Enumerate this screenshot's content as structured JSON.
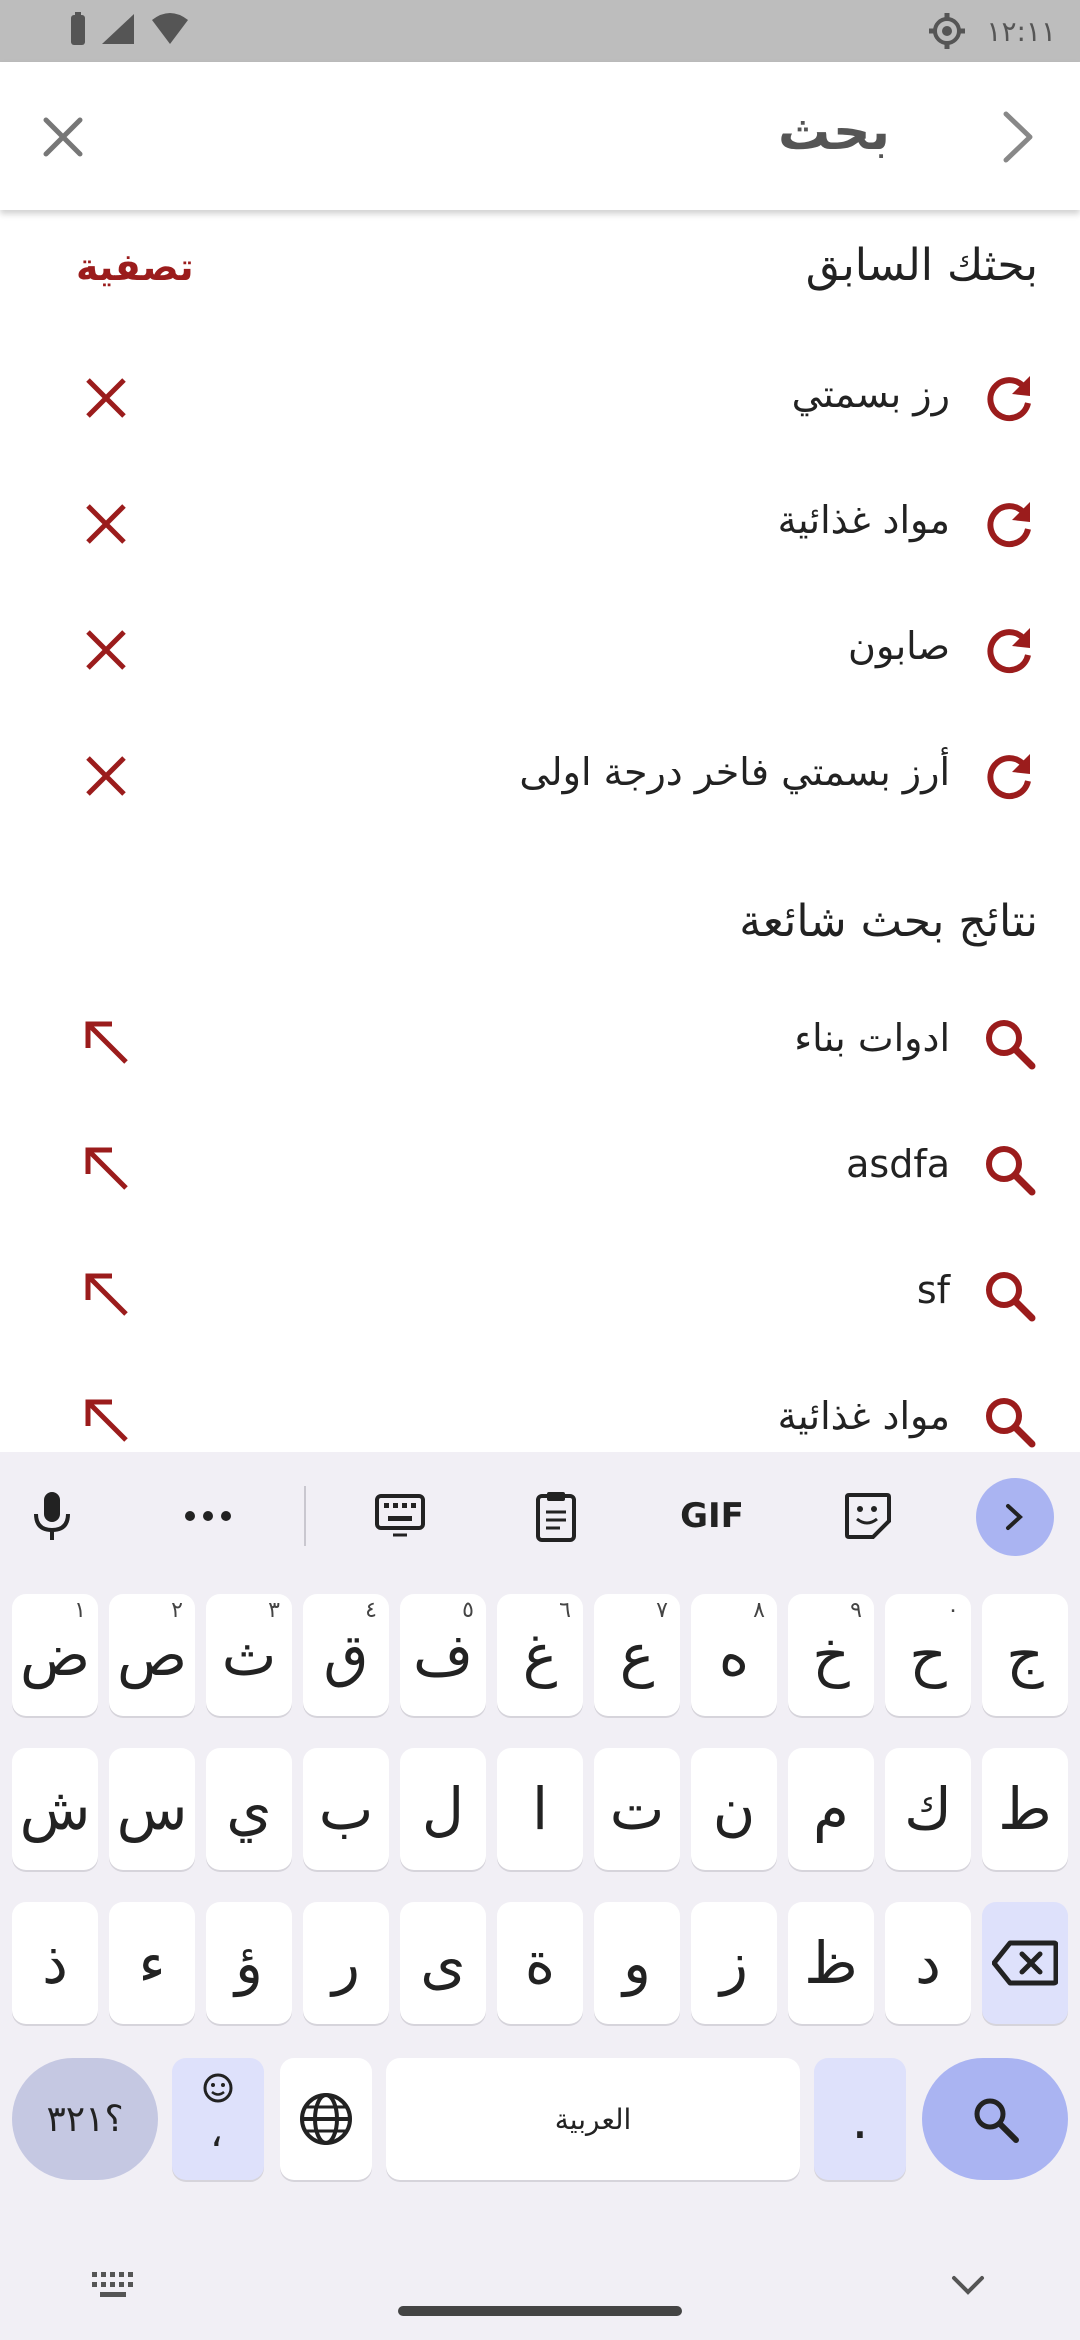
{
  "status_bar": {
    "time": "١٢:١١"
  },
  "app_bar": {
    "title": "بحث"
  },
  "history": {
    "title": "بحثك السابق",
    "clear_label": "تصفية",
    "items": [
      {
        "label": "رز بسمتي"
      },
      {
        "label": "مواد غذائية"
      },
      {
        "label": "صابون"
      },
      {
        "label": "أرز بسمتي فاخر درجة اولى"
      }
    ]
  },
  "popular": {
    "title": "نتائج بحث شائعة",
    "items": [
      {
        "label": "ادوات بناء"
      },
      {
        "label": "asdfa"
      },
      {
        "label": "sf"
      },
      {
        "label": "مواد غذائية"
      }
    ]
  },
  "keyboard": {
    "toolbar": {
      "gif_label": "GIF"
    },
    "row1": [
      {
        "char": "ض",
        "hint": "١"
      },
      {
        "char": "ص",
        "hint": "٢"
      },
      {
        "char": "ث",
        "hint": "٣"
      },
      {
        "char": "ق",
        "hint": "٤"
      },
      {
        "char": "ف",
        "hint": "٥"
      },
      {
        "char": "غ",
        "hint": "٦"
      },
      {
        "char": "ع",
        "hint": "٧"
      },
      {
        "char": "ه",
        "hint": "٨"
      },
      {
        "char": "خ",
        "hint": "٩"
      },
      {
        "char": "ح",
        "hint": "٠"
      },
      {
        "char": "ج",
        "hint": ""
      }
    ],
    "row2": [
      "ش",
      "س",
      "ي",
      "ب",
      "ل",
      "ا",
      "ت",
      "ن",
      "م",
      "ك",
      "ط"
    ],
    "row3": [
      "ذ",
      "ء",
      "ؤ",
      "ر",
      "ى",
      "ة",
      "و",
      "ز",
      "ظ",
      "د"
    ],
    "symbols_label": "؟٣٢١",
    "comma_label": "،",
    "space_label": "العربية",
    "period_label": "."
  },
  "colors": {
    "accent": "#9b1c1c",
    "keyboard_accent": "#aab4f2"
  }
}
